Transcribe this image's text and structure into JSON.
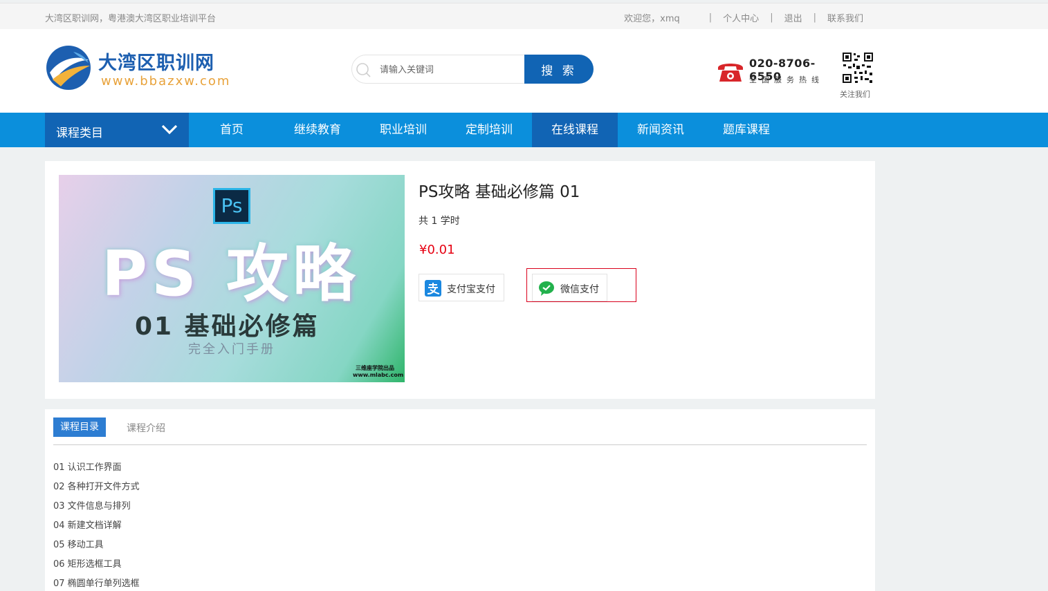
{
  "topbar": {
    "tagline": "大湾区职训网，粤港澳大湾区职业培训平台",
    "welcome": "欢迎您，xmq",
    "links": [
      "个人中心",
      "退出",
      "联系我们"
    ],
    "separator": "|"
  },
  "header": {
    "logo_title": "大湾区职训网",
    "logo_url": "www.bbazxw.com",
    "search_placeholder": "请输入关键词",
    "search_button": "搜 索",
    "hotline_number": "020-8706-6550",
    "hotline_label": "全国服务热线",
    "qr_label": "关注我们"
  },
  "nav": {
    "category_label": "课程类目",
    "items": [
      "首页",
      "继续教育",
      "职业培训",
      "定制培训",
      "在线课程",
      "新闻资讯",
      "题库课程"
    ],
    "active_index": 4
  },
  "course": {
    "cover_badge": "Ps",
    "cover_title": "PS 攻略",
    "cover_subtitle": "01 基础必修篇",
    "cover_subtitle2": "完全入门手册",
    "cover_mark1": "三维座学院出品",
    "cover_mark2": "www.mlabc.com",
    "title": "PS攻略 基础必修篇 01",
    "hours": "共 1 学时",
    "price": "¥0.01",
    "pay_alipay": "支付宝支付",
    "pay_wechat": "微信支付"
  },
  "panel": {
    "tab_catalog": "课程目录",
    "tab_intro": "课程介绍",
    "lessons": [
      "01 认识工作界面",
      "02 各种打开文件方式",
      "03 文件信息与排列",
      "04 新建文档详解",
      "05 移动工具",
      "06 矩形选框工具",
      "07 椭圆单行单列选框"
    ]
  },
  "colors": {
    "nav_bg": "#0b8fdc",
    "nav_active": "#1164b4",
    "price": "#e60012",
    "highlight_frame": "#d9001b"
  }
}
